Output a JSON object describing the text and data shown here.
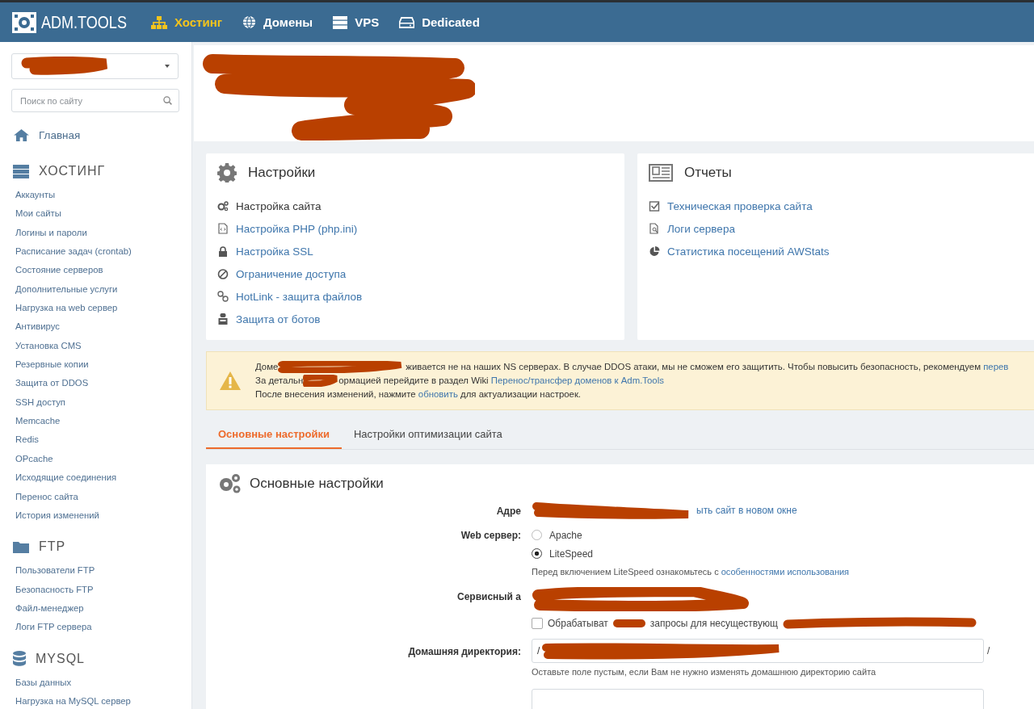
{
  "nav": {
    "logo": "ADM.TOOLS",
    "items": [
      {
        "label": "Хостинг",
        "selected": true
      },
      {
        "label": "Домены",
        "selected": false
      },
      {
        "label": "VPS",
        "selected": false
      },
      {
        "label": "Dedicated",
        "selected": false
      }
    ]
  },
  "sidebar": {
    "search": {
      "placeholder": "Поиск по сайту"
    },
    "home": "Главная",
    "sections": [
      {
        "title": "ХОСТИНГ",
        "items": [
          "Аккаунты",
          "Мои сайты",
          "Логины и пароли",
          "Расписание задач (crontab)",
          "Состояние серверов",
          "Дополнительные услуги",
          "Нагрузка на web сервер",
          "Антивирус",
          "Установка CMS",
          "Резервные копии",
          "Защита от DDOS",
          "SSH доступ",
          "Memcache",
          "Redis",
          "OPcache",
          "Исходящие соединения",
          "Перенос сайта",
          "История изменений"
        ]
      },
      {
        "title": "FTP",
        "items": [
          "Пользователи FTP",
          "Безопасность FTP",
          "Файл-менеджер",
          "Логи FTP сервера"
        ]
      },
      {
        "title": "MYSQL",
        "items": [
          "Базы данных",
          "Нагрузка на MySQL сервер"
        ]
      }
    ]
  },
  "panels": [
    {
      "title": "Настройки",
      "items": [
        {
          "label": "Настройка сайта",
          "selected": true
        },
        {
          "label": "Настройка PHP (php.ini)",
          "selected": false
        },
        {
          "label": "Настройка SSL",
          "selected": false
        },
        {
          "label": "Ограничение доступа",
          "selected": false
        },
        {
          "label": "HotLink - защита файлов",
          "selected": false
        },
        {
          "label": "Защита от ботов",
          "selected": false
        }
      ]
    },
    {
      "title": "Отчеты",
      "items": [
        {
          "label": "Техническая проверка сайта",
          "selected": false
        },
        {
          "label": "Логи сервера",
          "selected": false
        },
        {
          "label": "Статистика посещений AWStats",
          "selected": false
        }
      ]
    }
  ],
  "notice": {
    "lines": [
      [
        {
          "kind": "text",
          "text": "Доме"
        },
        {
          "kind": "gap"
        },
        {
          "kind": "text",
          "text": "живается не на наших NS серверах. В случае DDOS атаки, мы не сможем его защитить. Чтобы повысить безопасность, рекомендуем "
        },
        {
          "kind": "link",
          "text": "перев"
        }
      ],
      [
        {
          "kind": "text",
          "text": "За детальн"
        },
        {
          "kind": "gap"
        },
        {
          "kind": "text",
          "text": "ормацией перейдите в раздел Wiki "
        },
        {
          "kind": "link",
          "text": "Перенос/трансфер доменов к Adm.Tools"
        }
      ],
      [
        {
          "kind": "text",
          "text": "После внесения изменений, нажмите "
        },
        {
          "kind": "link",
          "text": "обновить"
        },
        {
          "kind": "text",
          "text": " для актуализации настроек."
        }
      ]
    ]
  },
  "tabs": [
    {
      "label": "Основные настройки",
      "selected": true
    },
    {
      "label": "Настройки оптимизации сайта",
      "selected": false
    }
  ],
  "form": {
    "title": "Основные настройки",
    "rows": [
      {
        "kind": "link",
        "label": "Адре",
        "link": "ыть сайт в новом окне"
      },
      {
        "kind": "radio",
        "label": "Web сервер:",
        "options": [
          {
            "label": "Apache",
            "selected": false
          },
          {
            "label": "LiteSpeed",
            "selected": true
          }
        ],
        "hint": [
          {
            "kind": "text",
            "text": "Перед включением LiteSpeed ознакомьтесь с "
          },
          {
            "kind": "link",
            "text": "особенностями использования"
          }
        ]
      },
      {
        "kind": "checks",
        "label": "Сервисный а",
        "options": [
          {
            "parts": [
              "Обрабатыват",
              "запросы для несуществующ"
            ],
            "checked": false
          }
        ]
      },
      {
        "kind": "input",
        "label": "Домашняя директория:",
        "value": "/",
        "suffix": "/",
        "hint": "Оставьте поле пустым, если Вам не нужно изменять домашнюю директорию сайта"
      }
    ]
  }
}
